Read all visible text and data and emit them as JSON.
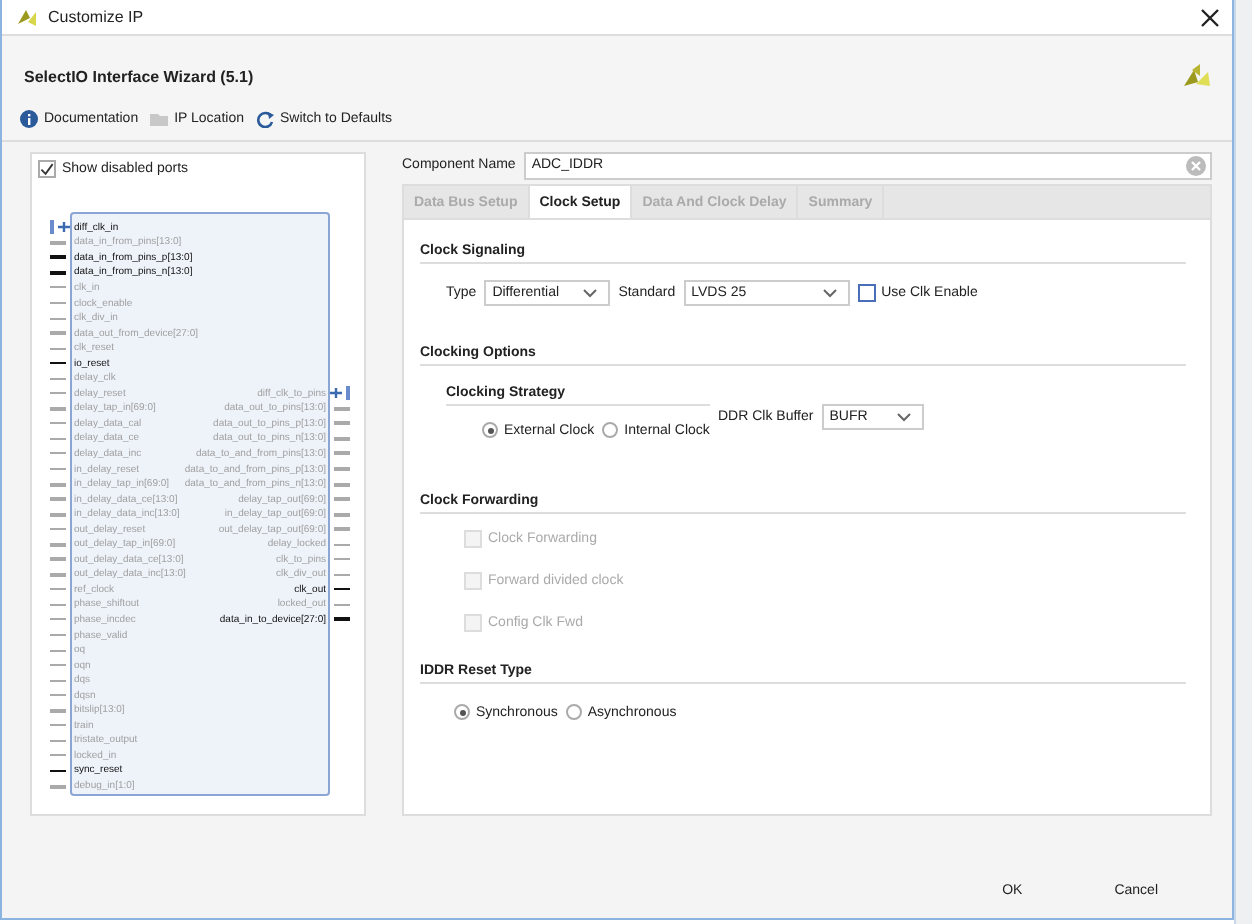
{
  "window": {
    "title": "Customize IP"
  },
  "header": {
    "title": "SelectIO Interface Wizard (5.1)"
  },
  "toolbar": [
    {
      "kind": "info",
      "label": "Documentation"
    },
    {
      "kind": "folder",
      "label": "IP Location"
    },
    {
      "kind": "refresh",
      "label": "Switch to Defaults"
    }
  ],
  "show_disabled_ports": {
    "label": "Show disabled ports",
    "checked": true
  },
  "symbol": {
    "rows": [
      {
        "left": {
          "name": "diff_clk_in",
          "enabled": true,
          "kind": "diff"
        }
      },
      {
        "left": {
          "name": "data_in_from_pins[13:0]",
          "enabled": false,
          "kind": "bus"
        }
      },
      {
        "left": {
          "name": "data_in_from_pins_p[13:0]",
          "enabled": true,
          "kind": "bus"
        }
      },
      {
        "left": {
          "name": "data_in_from_pins_n[13:0]",
          "enabled": true,
          "kind": "bus"
        }
      },
      {
        "left": {
          "name": "clk_in",
          "enabled": false,
          "kind": "single"
        }
      },
      {
        "left": {
          "name": "clock_enable",
          "enabled": false,
          "kind": "single"
        }
      },
      {
        "left": {
          "name": "clk_div_in",
          "enabled": false,
          "kind": "single"
        }
      },
      {
        "left": {
          "name": "data_out_from_device[27:0]",
          "enabled": false,
          "kind": "bus"
        }
      },
      {
        "left": {
          "name": "clk_reset",
          "enabled": false,
          "kind": "single"
        }
      },
      {
        "left": {
          "name": "io_reset",
          "enabled": true,
          "kind": "single"
        }
      },
      {
        "left": {
          "name": "delay_clk",
          "enabled": false,
          "kind": "single"
        }
      },
      {
        "left": {
          "name": "delay_reset",
          "enabled": false,
          "kind": "single"
        },
        "right": {
          "name": "diff_clk_to_pins",
          "enabled": false,
          "kind": "diff"
        }
      },
      {
        "left": {
          "name": "delay_tap_in[69:0]",
          "enabled": false,
          "kind": "bus"
        },
        "right": {
          "name": "data_out_to_pins[13:0]",
          "enabled": false,
          "kind": "bus"
        }
      },
      {
        "left": {
          "name": "delay_data_cal",
          "enabled": false,
          "kind": "single"
        },
        "right": {
          "name": "data_out_to_pins_p[13:0]",
          "enabled": false,
          "kind": "bus"
        }
      },
      {
        "left": {
          "name": "delay_data_ce",
          "enabled": false,
          "kind": "single"
        },
        "right": {
          "name": "data_out_to_pins_n[13:0]",
          "enabled": false,
          "kind": "bus"
        }
      },
      {
        "left": {
          "name": "delay_data_inc",
          "enabled": false,
          "kind": "single"
        },
        "right": {
          "name": "data_to_and_from_pins[13:0]",
          "enabled": false,
          "kind": "bus"
        }
      },
      {
        "left": {
          "name": "in_delay_reset",
          "enabled": false,
          "kind": "single"
        },
        "right": {
          "name": "data_to_and_from_pins_p[13:0]",
          "enabled": false,
          "kind": "bus"
        }
      },
      {
        "left": {
          "name": "in_delay_tap_in[69:0]",
          "enabled": false,
          "kind": "bus"
        },
        "right": {
          "name": "data_to_and_from_pins_n[13:0]",
          "enabled": false,
          "kind": "bus"
        }
      },
      {
        "left": {
          "name": "in_delay_data_ce[13:0]",
          "enabled": false,
          "kind": "bus"
        },
        "right": {
          "name": "delay_tap_out[69:0]",
          "enabled": false,
          "kind": "bus"
        }
      },
      {
        "left": {
          "name": "in_delay_data_inc[13:0]",
          "enabled": false,
          "kind": "bus"
        },
        "right": {
          "name": "in_delay_tap_out[69:0]",
          "enabled": false,
          "kind": "bus"
        }
      },
      {
        "left": {
          "name": "out_delay_reset",
          "enabled": false,
          "kind": "single"
        },
        "right": {
          "name": "out_delay_tap_out[69:0]",
          "enabled": false,
          "kind": "bus"
        }
      },
      {
        "left": {
          "name": "out_delay_tap_in[69:0]",
          "enabled": false,
          "kind": "bus"
        },
        "right": {
          "name": "delay_locked",
          "enabled": false,
          "kind": "single"
        }
      },
      {
        "left": {
          "name": "out_delay_data_ce[13:0]",
          "enabled": false,
          "kind": "bus"
        },
        "right": {
          "name": "clk_to_pins",
          "enabled": false,
          "kind": "single"
        }
      },
      {
        "left": {
          "name": "out_delay_data_inc[13:0]",
          "enabled": false,
          "kind": "bus"
        },
        "right": {
          "name": "clk_div_out",
          "enabled": false,
          "kind": "single"
        }
      },
      {
        "left": {
          "name": "ref_clock",
          "enabled": false,
          "kind": "single"
        },
        "right": {
          "name": "clk_out",
          "enabled": true,
          "kind": "single"
        }
      },
      {
        "left": {
          "name": "phase_shiftout",
          "enabled": false,
          "kind": "single"
        },
        "right": {
          "name": "locked_out",
          "enabled": false,
          "kind": "single"
        }
      },
      {
        "left": {
          "name": "phase_incdec",
          "enabled": false,
          "kind": "single"
        },
        "right": {
          "name": "data_in_to_device[27:0]",
          "enabled": true,
          "kind": "bus"
        }
      },
      {
        "left": {
          "name": "phase_valid",
          "enabled": false,
          "kind": "single"
        }
      },
      {
        "left": {
          "name": "oq",
          "enabled": false,
          "kind": "single"
        }
      },
      {
        "left": {
          "name": "oqn",
          "enabled": false,
          "kind": "single"
        }
      },
      {
        "left": {
          "name": "dqs",
          "enabled": false,
          "kind": "single"
        }
      },
      {
        "left": {
          "name": "dqsn",
          "enabled": false,
          "kind": "single"
        }
      },
      {
        "left": {
          "name": "bitslip[13:0]",
          "enabled": false,
          "kind": "bus"
        }
      },
      {
        "left": {
          "name": "train",
          "enabled": false,
          "kind": "single"
        }
      },
      {
        "left": {
          "name": "tristate_output",
          "enabled": false,
          "kind": "single"
        }
      },
      {
        "left": {
          "name": "locked_in",
          "enabled": false,
          "kind": "single"
        }
      },
      {
        "left": {
          "name": "sync_reset",
          "enabled": true,
          "kind": "single"
        }
      },
      {
        "left": {
          "name": "debug_in[1:0]",
          "enabled": false,
          "kind": "bus"
        }
      }
    ]
  },
  "component_name": {
    "label": "Component Name",
    "value": "ADC_IDDR"
  },
  "tabs": [
    {
      "label": "Data Bus Setup",
      "selected": false
    },
    {
      "label": "Clock Setup",
      "selected": true
    },
    {
      "label": "Data And Clock Delay",
      "selected": false
    },
    {
      "label": "Summary",
      "selected": false
    }
  ],
  "clock_signaling": {
    "title": "Clock Signaling",
    "type_label": "Type",
    "type_value": "Differential",
    "standard_label": "Standard",
    "standard_value": "LVDS 25",
    "use_clk_enable": {
      "label": "Use Clk Enable",
      "checked": false
    }
  },
  "clocking_options": {
    "title": "Clocking Options",
    "strategy_title": "Clocking Strategy",
    "strategy": [
      {
        "label": "External Clock",
        "selected": true
      },
      {
        "label": "Internal Clock",
        "selected": false
      }
    ],
    "buffer_label": "DDR Clk Buffer",
    "buffer_value": "BUFR"
  },
  "clock_forwarding": {
    "title": "Clock Forwarding",
    "options": [
      {
        "label": "Clock Forwarding",
        "checked": false,
        "disabled": true
      },
      {
        "label": "Forward divided clock",
        "checked": false,
        "disabled": true
      },
      {
        "label": "Config Clk Fwd",
        "checked": false,
        "disabled": true
      }
    ]
  },
  "reset_type": {
    "title": "IDDR Reset Type",
    "options": [
      {
        "label": "Synchronous",
        "selected": true
      },
      {
        "label": "Asynchronous",
        "selected": false
      }
    ]
  },
  "buttons": [
    {
      "label": "OK"
    },
    {
      "label": "Cancel"
    }
  ]
}
